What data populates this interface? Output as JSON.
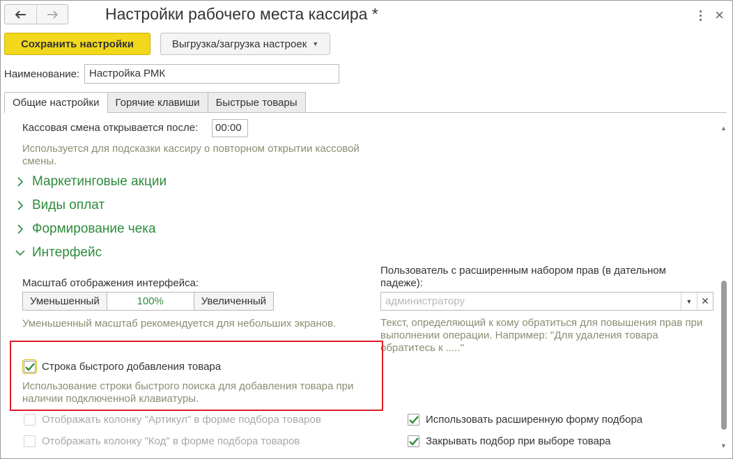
{
  "window": {
    "title": "Настройки рабочего места кассира *",
    "back_icon": "arrow-left-icon",
    "forward_icon": "arrow-right-icon"
  },
  "toolbar": {
    "save_label": "Сохранить настройки",
    "export_label": "Выгрузка/загрузка настроек"
  },
  "name_field": {
    "label": "Наименование:",
    "value": "Настройка РМК"
  },
  "tabs": [
    {
      "label": "Общие настройки",
      "active": true
    },
    {
      "label": "Горячие клавиши",
      "active": false
    },
    {
      "label": "Быстрые товары",
      "active": false
    }
  ],
  "shift": {
    "label": "Кассовая смена открывается после:",
    "value": "00:00",
    "hint_line1": "Используется для подсказки кассиру о повторном открытии кассовой",
    "hint_line2": "смены."
  },
  "sections": [
    {
      "label": "Маркетинговые акции",
      "expanded": false
    },
    {
      "label": "Виды оплат",
      "expanded": false
    },
    {
      "label": "Формирование чека",
      "expanded": false
    },
    {
      "label": "Интерфейс",
      "expanded": true
    }
  ],
  "interface": {
    "scale_label": "Масштаб отображения интерфейса:",
    "scale_decrease": "Уменьшенный",
    "scale_value": "100%",
    "scale_increase": "Увеличенный",
    "scale_hint": "Уменьшенный масштаб рекомендуется для небольших экранов.",
    "user_label_line1": "Пользователь с расширенным набором прав (в дательном",
    "user_label_line2": "падеже):",
    "user_placeholder": "администратору",
    "user_hint_line1": "Текст, определяющий к кому обратиться для повышения прав при",
    "user_hint_line2": "выполнении операции. Например: \"Для удаления товара",
    "user_hint_line3": "обратитесь к .....\"",
    "quick_add_label": "Строка быстрого добавления товара",
    "quick_add_checked": true,
    "quick_add_hint_line1": "Использование строки быстрого поиска для добавления товара при",
    "quick_add_hint_line2": "наличии подключенной клавиатуры.",
    "article_col_label": "Отображать колонку \"Артикул\" в форме подбора товаров",
    "article_col_checked": false,
    "code_col_label": "Отображать колонку \"Код\" в форме подбора товаров",
    "code_col_checked": false,
    "ext_pick_label": "Использовать расширенную форму подбора",
    "ext_pick_checked": true,
    "close_pick_label": "Закрывать подбор при выборе товара",
    "close_pick_checked": true
  },
  "colors": {
    "accent_green": "#2e8b3c",
    "save_yellow": "#f2d81c",
    "highlight_red": "#dd1e24",
    "hint_text": "#8c8c72"
  }
}
